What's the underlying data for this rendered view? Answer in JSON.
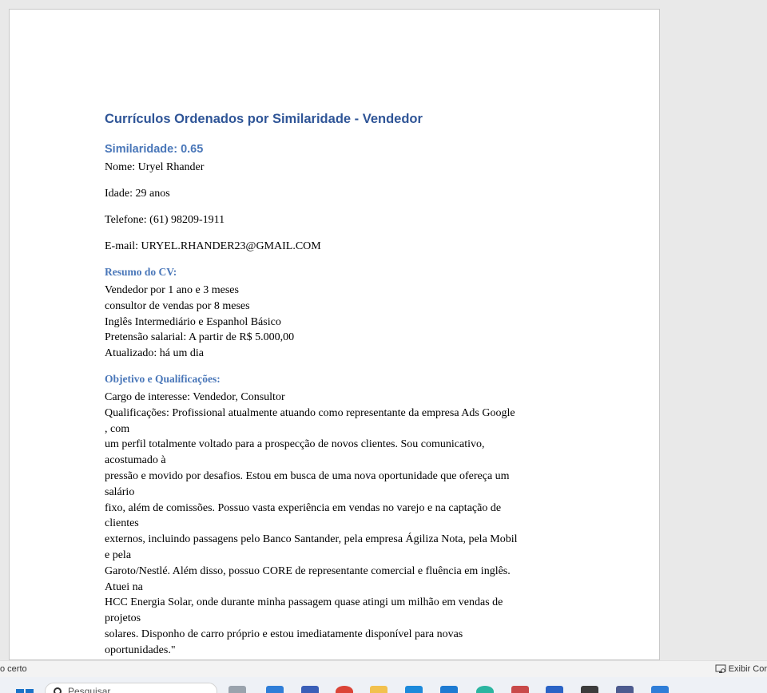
{
  "document": {
    "title": "Currículos Ordenados por Similaridade - Vendedor",
    "entry": {
      "similarity_label": "Similaridade: 0.65",
      "fields": [
        "Nome: Uryel Rhander",
        "Idade: 29 anos",
        "Telefone: (61) 98209-1911",
        "E-mail: URYEL.RHANDER23@GMAIL.COM"
      ],
      "summary_heading": "Resumo do CV:",
      "summary_lines": [
        "Vendedor por 1 ano e 3 meses",
        "consultor de vendas por 8 meses",
        "Inglês Intermediário e Espanhol Básico",
        "Pretensão salarial: A partir de R$ 5.000,00",
        "Atualizado: há um dia"
      ],
      "objective_heading": "Objetivo e Qualificações:",
      "objective_lines": [
        "Cargo de interesse: Vendedor, Consultor",
        "Qualificações: Profissional atualmente atuando como representante da empresa Ads Google",
        ", com",
        "um perfil totalmente voltado para a prospecção de novos clientes. Sou comunicativo,",
        "acostumado à",
        "pressão e movido por desafios. Estou em busca de uma nova oportunidade que ofereça um",
        "salário",
        "fixo, além de comissões. Possuo vasta experiência em vendas no varejo e na captação de",
        "clientes",
        "externos, incluindo passagens pelo Banco Santander, pela empresa Ágiliza Nota, pela Mobil",
        "e pela",
        "Garoto/Nestlé. Além disso, possuo CORE de representante comercial e fluência em inglês.",
        "Atuei na",
        "HCC Energia Solar, onde durante minha passagem quase atingi um milhão em vendas de",
        "projetos",
        "solares. Disponho de carro próprio e estou imediatamente disponível para novas",
        "oportunidades.\""
      ]
    }
  },
  "statusbar": {
    "left_text": "o certo",
    "right_text": "Exibir Cor",
    "right_icon": "focus-view-icon"
  },
  "taskbar": {
    "search_placeholder": "Pesquisar"
  }
}
